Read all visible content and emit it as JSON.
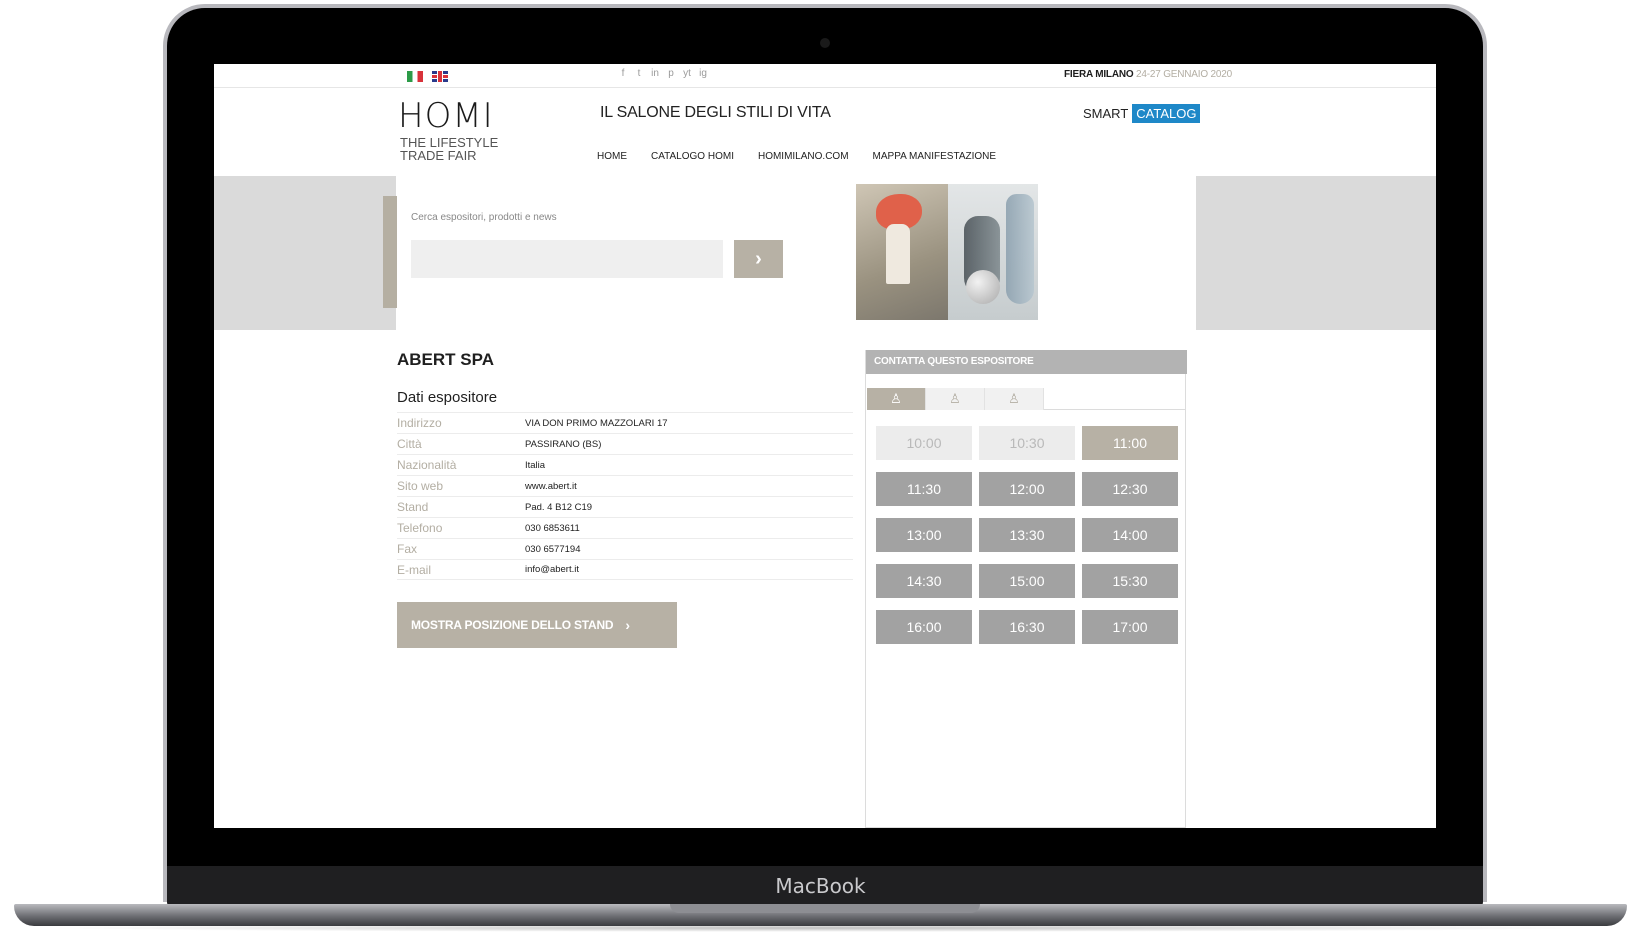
{
  "device": {
    "brand": "MacBook"
  },
  "topbar": {
    "social": [
      "f",
      "t",
      "in",
      "p",
      "yt",
      "ig"
    ],
    "fair_place": "FIERA MILANO",
    "fair_dates": "24-27 GENNAIO 2020"
  },
  "header": {
    "logo": "HOMI",
    "logo_sub": "THE LIFESTYLE TRADE FAIR",
    "tagline": "IL SALONE DEGLI STILI DI VITA",
    "smart": "SMART",
    "catalog": "CATALOG"
  },
  "nav": [
    "HOME",
    "CATALOGO HOMI",
    "HOMIMILANO.COM",
    "MAPPA MANIFESTAZIONE"
  ],
  "search": {
    "label": "Cerca espositori, prodotti e news",
    "value": "",
    "button": "›"
  },
  "exhibitor": {
    "name": "ABERT SPA",
    "section_title": "Dati espositore",
    "details": [
      {
        "label": "Indirizzo",
        "value": "VIA DON PRIMO MAZZOLARI 17"
      },
      {
        "label": "Città",
        "value": "PASSIRANO (BS)"
      },
      {
        "label": "Nazionalità",
        "value": "Italia"
      },
      {
        "label": "Sito web",
        "value": "www.abert.it"
      },
      {
        "label": "Stand",
        "value": "Pad. 4 B12 C19"
      },
      {
        "label": "Telefono",
        "value": "030 6853611"
      },
      {
        "label": "Fax",
        "value": "030 6577194"
      },
      {
        "label": "E-mail",
        "value": "info@abert.it"
      }
    ],
    "stand_button": "MOSTRA POSIZIONE DELLO STAND",
    "stand_button_chevron": "›"
  },
  "contact": {
    "header": "CONTATTA QUESTO ESPOSITORE",
    "tabs": [
      {
        "icon": "person-icon",
        "glyph": "♙",
        "active": true
      },
      {
        "icon": "person-icon",
        "glyph": "♙",
        "active": false
      },
      {
        "icon": "person-icon",
        "glyph": "♙",
        "active": false
      }
    ],
    "slots": [
      {
        "time": "10:00",
        "state": "disabled"
      },
      {
        "time": "10:30",
        "state": "disabled"
      },
      {
        "time": "11:00",
        "state": "selected"
      },
      {
        "time": "11:30",
        "state": "available"
      },
      {
        "time": "12:00",
        "state": "available"
      },
      {
        "time": "12:30",
        "state": "available"
      },
      {
        "time": "13:00",
        "state": "available"
      },
      {
        "time": "13:30",
        "state": "available"
      },
      {
        "time": "14:00",
        "state": "available"
      },
      {
        "time": "14:30",
        "state": "available"
      },
      {
        "time": "15:00",
        "state": "available"
      },
      {
        "time": "15:30",
        "state": "available"
      },
      {
        "time": "16:00",
        "state": "available"
      },
      {
        "time": "16:30",
        "state": "available"
      },
      {
        "time": "17:00",
        "state": "available"
      }
    ]
  },
  "colors": {
    "accent_taupe": "#b7b1a5",
    "catalog_blue": "#1e88c8",
    "slot_gray": "#a2a2a2",
    "hero_band": "#dadada"
  }
}
